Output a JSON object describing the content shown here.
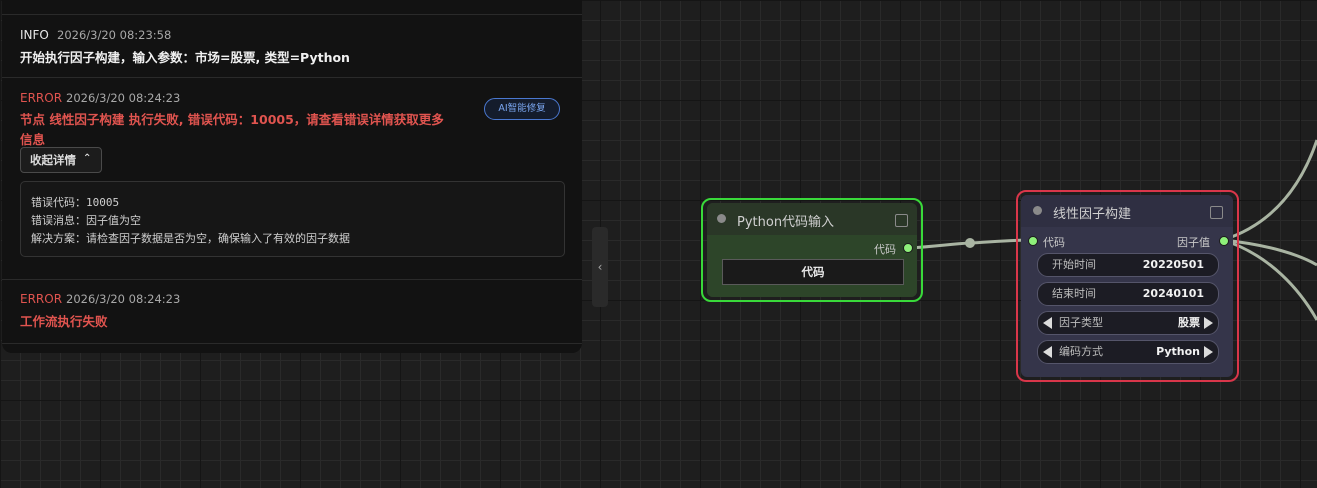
{
  "log_panel": {
    "entries": [
      {
        "level": "INFO",
        "time": "2026/3/20 08:23:58",
        "message": "开始执行因子构建，输入参数：市场=股票, 类型=Python"
      },
      {
        "level": "ERROR",
        "time": "2026/3/20 08:24:23",
        "message_line1": "节点 线性因子构建 执行失败, 错误代码：10005，请查看错误详情获取更多",
        "message_line2": "信息",
        "ai_fix_label": "AI智能修复",
        "collapse_label": "收起详情",
        "details": [
          "错误代码：10005",
          "错误消息：因子值为空",
          "解决方案：请检查因子数据是否为空，确保输入了有效的因子数据"
        ]
      },
      {
        "level": "ERROR",
        "time": "2026/3/20 08:24:23",
        "message": "工作流执行失败"
      }
    ]
  },
  "nodes": {
    "python_input": {
      "title": "Python代码输入",
      "output_label": "代码",
      "button_label": "代码",
      "accent": "#39d93a"
    },
    "linear_factor": {
      "title": "线性因子构建",
      "input_label": "代码",
      "output_label": "因子值",
      "accent": "#d9364a",
      "widgets": [
        {
          "label": "开始时间",
          "value": "20220501"
        },
        {
          "label": "结束时间",
          "value": "20240101"
        },
        {
          "label": "因子类型",
          "value": "股票"
        },
        {
          "label": "编码方式",
          "value": "Python"
        }
      ]
    }
  }
}
